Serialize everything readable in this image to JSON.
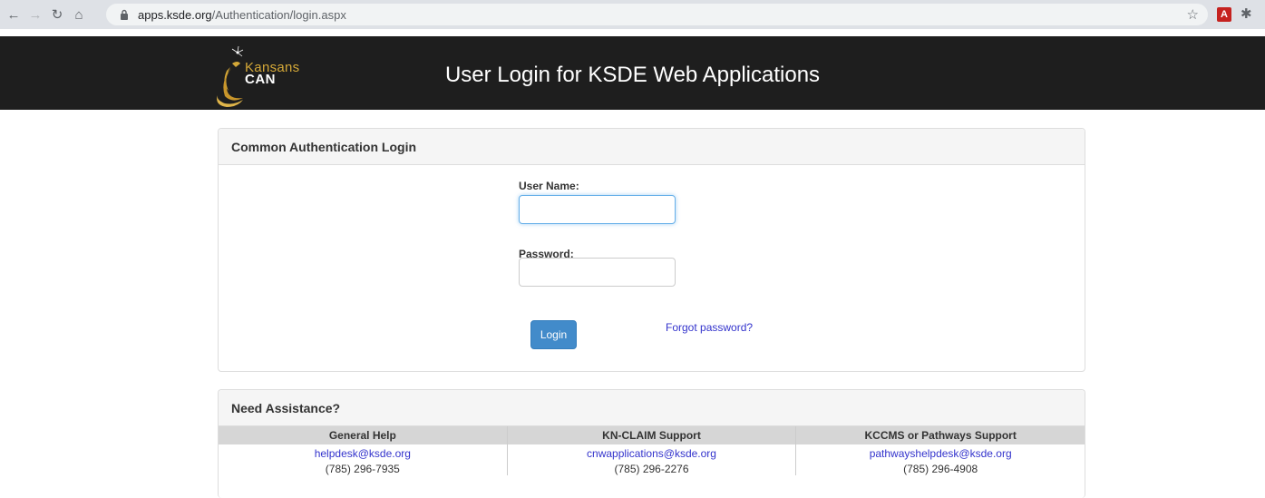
{
  "browser": {
    "url_domain": "apps.ksde.org",
    "url_path": "/Authentication/login.aspx",
    "pdf_ext_label": "A"
  },
  "header": {
    "logo_kansans": "Kansans",
    "logo_can": "CAN",
    "title": "User Login for KSDE Web Applications"
  },
  "login": {
    "heading": "Common Authentication Login",
    "username_label": "User Name:",
    "username_value": "",
    "password_label": "Password:",
    "password_value": "",
    "login_button": "Login",
    "forgot_link": "Forgot password?"
  },
  "assistance": {
    "heading": "Need Assistance?",
    "columns": [
      {
        "title": "General Help",
        "email": "helpdesk@ksde.org",
        "phone": "(785) 296-7935"
      },
      {
        "title": "KN-CLAIM Support",
        "email": "cnwapplications@ksde.org",
        "phone": "(785) 296-2276"
      },
      {
        "title": "KCCMS or Pathways Support",
        "email": "pathwayshelpdesk@ksde.org",
        "phone": "(785) 296-4908"
      }
    ]
  },
  "colors": {
    "header_bg": "#1e1e1e",
    "logo_gold": "#d4a838",
    "button_blue": "#428bca",
    "link_blue": "#3333cc"
  }
}
